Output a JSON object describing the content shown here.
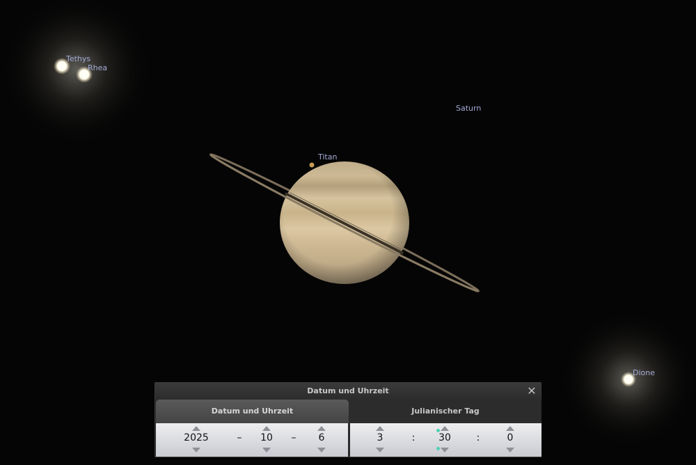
{
  "sky": {
    "labels": {
      "tethys": "Tethys",
      "rhea": "Rhea",
      "saturn": "Saturn",
      "titan": "Titan",
      "dione": "Dione"
    },
    "label_color": "#a6acd6"
  },
  "dialog": {
    "title": "Datum und Uhrzeit",
    "close": "✕",
    "tabs": {
      "datetime": "Datum und Uhrzeit",
      "julian": "Julianischer Tag"
    },
    "date": {
      "year": "2025",
      "sep1": "–",
      "month": "10",
      "sep2": "–",
      "day": "6"
    },
    "time": {
      "hour": "3",
      "sep1": ":",
      "minute": "30",
      "sep2": ":",
      "second": "0"
    }
  }
}
